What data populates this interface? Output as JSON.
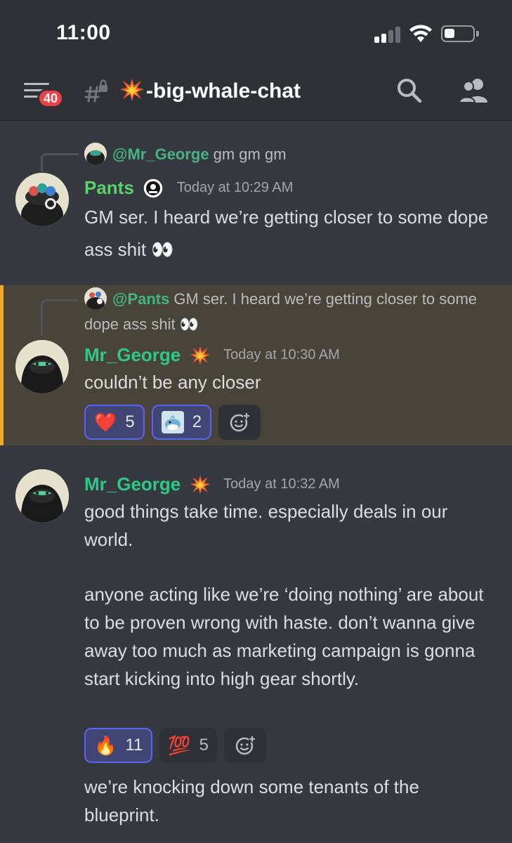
{
  "status_bar": {
    "time": "11:00"
  },
  "header": {
    "unread_badge": "40",
    "channel_name": "-big-whale-chat"
  },
  "messages": [
    {
      "reply_to": {
        "mention": "@Mr_George",
        "text": "gm gm gm"
      },
      "author": "Pants",
      "timestamp": "Today at 10:29 AM",
      "content": "GM ser. I heard we’re getting closer to some dope ass shit 👀"
    },
    {
      "reply_to": {
        "mention": "@Pants",
        "text": "GM ser. I heard we’re getting closer to some dope ass shit 👀"
      },
      "author": "Mr_George",
      "timestamp": "Today at 10:30 AM",
      "content": "couldn’t be any closer",
      "reactions": [
        {
          "emoji": "❤️",
          "count": "5"
        },
        {
          "emoji": "whale",
          "count": "2"
        }
      ]
    },
    {
      "author": "Mr_George",
      "timestamp": "Today at 10:32 AM",
      "content_paragraphs": [
        "good things take time. especially deals in our world.",
        "anyone acting like we’re ‘doing nothing’ are about to be proven wrong with haste. don’t wanna give away too much as marketing campaign is gonna start kicking into high gear shortly."
      ],
      "reactions": [
        {
          "emoji": "🔥",
          "count": "11"
        },
        {
          "emoji": "💯",
          "count": "5"
        }
      ]
    },
    {
      "content": "we’re knocking down some tenants of the blueprint."
    }
  ],
  "colors": {
    "background": "#36393f",
    "header": "#2f3136",
    "highlight": "#49443a",
    "highlight_border": "#f0a82a",
    "pants_name": "#57d36a",
    "george_name": "#2ec989",
    "badge": "#ed4245",
    "reaction_active": "#5865f2"
  }
}
